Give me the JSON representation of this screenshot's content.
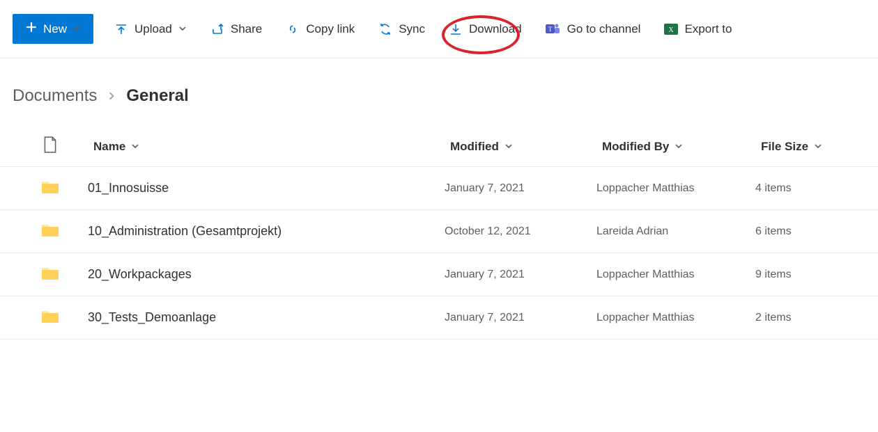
{
  "toolbar": {
    "new_label": "New",
    "upload_label": "Upload",
    "share_label": "Share",
    "copylink_label": "Copy link",
    "sync_label": "Sync",
    "download_label": "Download",
    "channel_label": "Go to channel",
    "export_label": "Export to"
  },
  "breadcrumb": {
    "root": "Documents",
    "current": "General"
  },
  "columns": {
    "name": "Name",
    "modified": "Modified",
    "modified_by": "Modified By",
    "file_size": "File Size"
  },
  "rows": [
    {
      "name": "01_Innosuisse",
      "modified": "January 7, 2021",
      "modified_by": "Loppacher Matthias",
      "file_size": "4 items"
    },
    {
      "name": "10_Administration (Gesamtprojekt)",
      "modified": "October 12, 2021",
      "modified_by": "Lareida Adrian",
      "file_size": "6 items"
    },
    {
      "name": "20_Workpackages",
      "modified": "January 7, 2021",
      "modified_by": "Loppacher Matthias",
      "file_size": "9 items"
    },
    {
      "name": "30_Tests_Demoanlage",
      "modified": "January 7, 2021",
      "modified_by": "Loppacher Matthias",
      "file_size": "2 items"
    }
  ]
}
